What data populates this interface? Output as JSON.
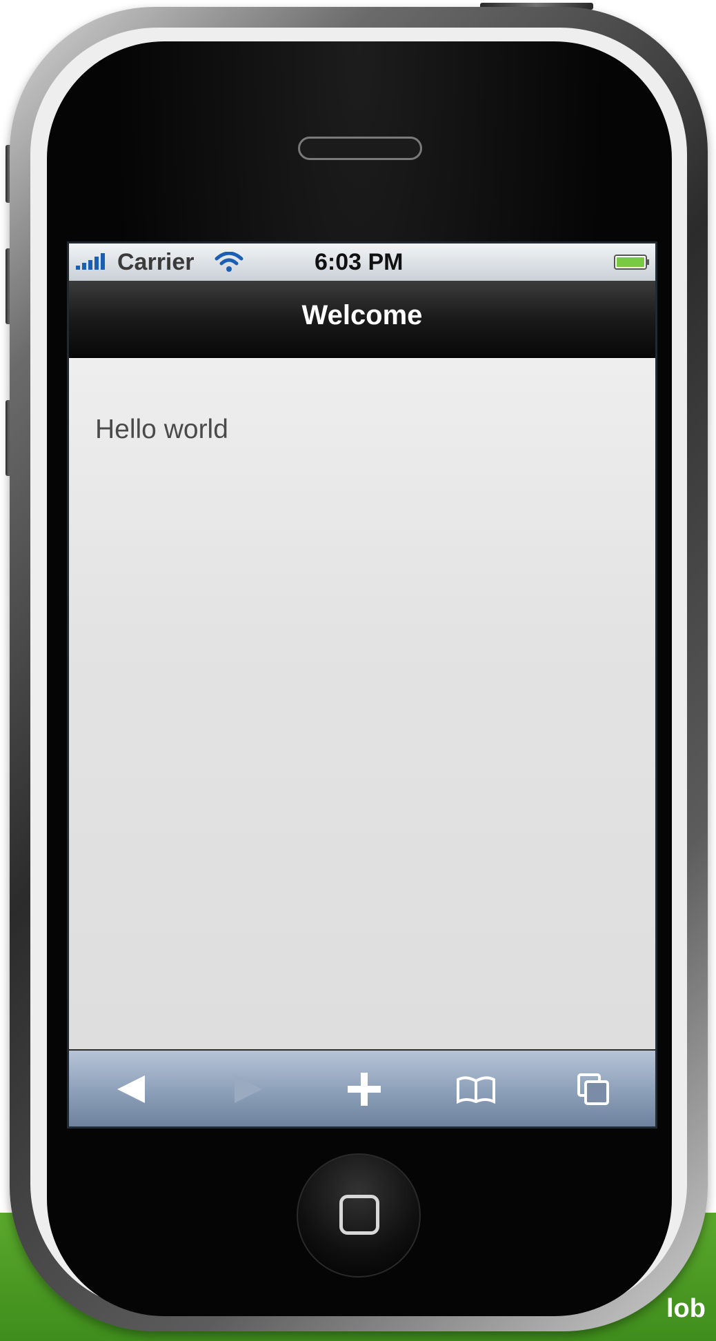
{
  "status_bar": {
    "carrier": "Carrier",
    "time": "6:03 PM",
    "signal_icon": "signal-bars-icon",
    "wifi_icon": "wifi-icon",
    "battery_icon": "battery-icon",
    "battery_color": "#7ac943"
  },
  "nav_bar": {
    "title": "Welcome"
  },
  "content": {
    "text": "Hello world"
  },
  "toolbar": {
    "items": [
      {
        "icon": "back-arrow-icon",
        "enabled": true
      },
      {
        "icon": "forward-arrow-icon",
        "enabled": false
      },
      {
        "icon": "plus-icon",
        "enabled": true
      },
      {
        "icon": "bookmarks-icon",
        "enabled": true
      },
      {
        "icon": "pages-icon",
        "enabled": true
      }
    ]
  },
  "background": {
    "banner_text": "lob",
    "accent": "#4a9a24"
  }
}
